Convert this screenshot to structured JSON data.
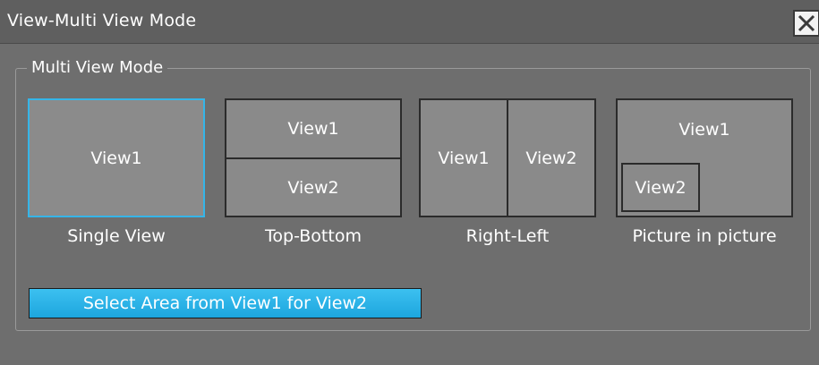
{
  "window": {
    "title": "View-Multi View Mode"
  },
  "group": {
    "label": "Multi View Mode"
  },
  "modes": [
    {
      "caption": "Single View",
      "panes": [
        "View1"
      ],
      "selected": true
    },
    {
      "caption": "Top-Bottom",
      "panes": [
        "View1",
        "View2"
      ],
      "selected": false
    },
    {
      "caption": "Right-Left",
      "panes": [
        "View1",
        "View2"
      ],
      "selected": false
    },
    {
      "caption": "Picture in picture",
      "panes": [
        "View1",
        "View2"
      ],
      "selected": false
    }
  ],
  "actions": {
    "select_area_label": "Select Area from View1 for View2"
  },
  "colors": {
    "accent": "#35b5e8",
    "button": "#1da6de",
    "background": "#6e6e6e"
  }
}
